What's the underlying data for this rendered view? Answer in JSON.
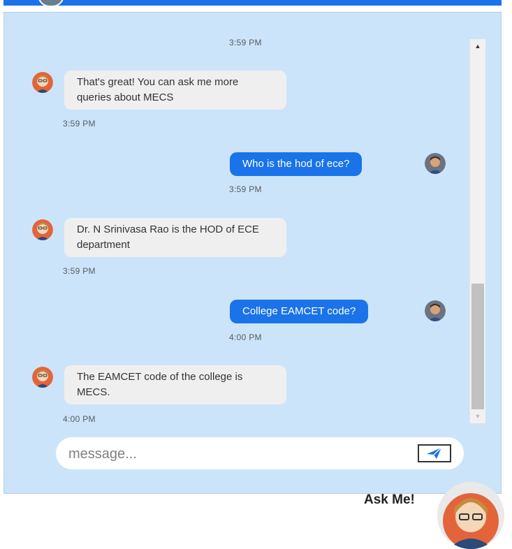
{
  "chat": {
    "messages": [
      {
        "sender": "bot",
        "text": "That's great! You can ask me more queries about MECS",
        "time": "3:59 PM"
      },
      {
        "sender": "user",
        "text": "Who is the hod of ece?",
        "time": "3:59 PM"
      },
      {
        "sender": "bot",
        "text": "Dr. N Srinivasa Rao is the HOD of ECE department",
        "time": "3:59 PM"
      },
      {
        "sender": "user",
        "text": "College EAMCET code?",
        "time": "4:00 PM"
      },
      {
        "sender": "bot",
        "text": "The EAMCET code of the college is MECS.",
        "time": "4:00 PM"
      }
    ],
    "top_time": "3:59 PM"
  },
  "input": {
    "placeholder": "message..."
  },
  "launcher": {
    "label": "Ask Me!"
  },
  "colors": {
    "accent": "#1a73e8",
    "panel_bg": "#cce4f9",
    "bot_bubble": "#efefef"
  },
  "icons": {
    "send": "send-plane-icon",
    "bot_avatar": "bot-avatar-icon",
    "user_avatar": "user-avatar-icon"
  }
}
